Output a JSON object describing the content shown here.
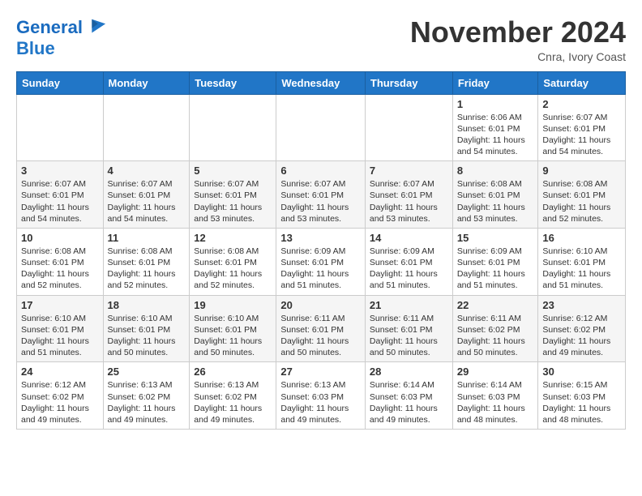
{
  "header": {
    "logo_line1": "General",
    "logo_line2": "Blue",
    "month_title": "November 2024",
    "location": "Cnra, Ivory Coast"
  },
  "days_of_week": [
    "Sunday",
    "Monday",
    "Tuesday",
    "Wednesday",
    "Thursday",
    "Friday",
    "Saturday"
  ],
  "weeks": [
    [
      {
        "day": "",
        "info": ""
      },
      {
        "day": "",
        "info": ""
      },
      {
        "day": "",
        "info": ""
      },
      {
        "day": "",
        "info": ""
      },
      {
        "day": "",
        "info": ""
      },
      {
        "day": "1",
        "info": "Sunrise: 6:06 AM\nSunset: 6:01 PM\nDaylight: 11 hours and 54 minutes."
      },
      {
        "day": "2",
        "info": "Sunrise: 6:07 AM\nSunset: 6:01 PM\nDaylight: 11 hours and 54 minutes."
      }
    ],
    [
      {
        "day": "3",
        "info": "Sunrise: 6:07 AM\nSunset: 6:01 PM\nDaylight: 11 hours and 54 minutes."
      },
      {
        "day": "4",
        "info": "Sunrise: 6:07 AM\nSunset: 6:01 PM\nDaylight: 11 hours and 54 minutes."
      },
      {
        "day": "5",
        "info": "Sunrise: 6:07 AM\nSunset: 6:01 PM\nDaylight: 11 hours and 53 minutes."
      },
      {
        "day": "6",
        "info": "Sunrise: 6:07 AM\nSunset: 6:01 PM\nDaylight: 11 hours and 53 minutes."
      },
      {
        "day": "7",
        "info": "Sunrise: 6:07 AM\nSunset: 6:01 PM\nDaylight: 11 hours and 53 minutes."
      },
      {
        "day": "8",
        "info": "Sunrise: 6:08 AM\nSunset: 6:01 PM\nDaylight: 11 hours and 53 minutes."
      },
      {
        "day": "9",
        "info": "Sunrise: 6:08 AM\nSunset: 6:01 PM\nDaylight: 11 hours and 52 minutes."
      }
    ],
    [
      {
        "day": "10",
        "info": "Sunrise: 6:08 AM\nSunset: 6:01 PM\nDaylight: 11 hours and 52 minutes."
      },
      {
        "day": "11",
        "info": "Sunrise: 6:08 AM\nSunset: 6:01 PM\nDaylight: 11 hours and 52 minutes."
      },
      {
        "day": "12",
        "info": "Sunrise: 6:08 AM\nSunset: 6:01 PM\nDaylight: 11 hours and 52 minutes."
      },
      {
        "day": "13",
        "info": "Sunrise: 6:09 AM\nSunset: 6:01 PM\nDaylight: 11 hours and 51 minutes."
      },
      {
        "day": "14",
        "info": "Sunrise: 6:09 AM\nSunset: 6:01 PM\nDaylight: 11 hours and 51 minutes."
      },
      {
        "day": "15",
        "info": "Sunrise: 6:09 AM\nSunset: 6:01 PM\nDaylight: 11 hours and 51 minutes."
      },
      {
        "day": "16",
        "info": "Sunrise: 6:10 AM\nSunset: 6:01 PM\nDaylight: 11 hours and 51 minutes."
      }
    ],
    [
      {
        "day": "17",
        "info": "Sunrise: 6:10 AM\nSunset: 6:01 PM\nDaylight: 11 hours and 51 minutes."
      },
      {
        "day": "18",
        "info": "Sunrise: 6:10 AM\nSunset: 6:01 PM\nDaylight: 11 hours and 50 minutes."
      },
      {
        "day": "19",
        "info": "Sunrise: 6:10 AM\nSunset: 6:01 PM\nDaylight: 11 hours and 50 minutes."
      },
      {
        "day": "20",
        "info": "Sunrise: 6:11 AM\nSunset: 6:01 PM\nDaylight: 11 hours and 50 minutes."
      },
      {
        "day": "21",
        "info": "Sunrise: 6:11 AM\nSunset: 6:01 PM\nDaylight: 11 hours and 50 minutes."
      },
      {
        "day": "22",
        "info": "Sunrise: 6:11 AM\nSunset: 6:02 PM\nDaylight: 11 hours and 50 minutes."
      },
      {
        "day": "23",
        "info": "Sunrise: 6:12 AM\nSunset: 6:02 PM\nDaylight: 11 hours and 49 minutes."
      }
    ],
    [
      {
        "day": "24",
        "info": "Sunrise: 6:12 AM\nSunset: 6:02 PM\nDaylight: 11 hours and 49 minutes."
      },
      {
        "day": "25",
        "info": "Sunrise: 6:13 AM\nSunset: 6:02 PM\nDaylight: 11 hours and 49 minutes."
      },
      {
        "day": "26",
        "info": "Sunrise: 6:13 AM\nSunset: 6:02 PM\nDaylight: 11 hours and 49 minutes."
      },
      {
        "day": "27",
        "info": "Sunrise: 6:13 AM\nSunset: 6:03 PM\nDaylight: 11 hours and 49 minutes."
      },
      {
        "day": "28",
        "info": "Sunrise: 6:14 AM\nSunset: 6:03 PM\nDaylight: 11 hours and 49 minutes."
      },
      {
        "day": "29",
        "info": "Sunrise: 6:14 AM\nSunset: 6:03 PM\nDaylight: 11 hours and 48 minutes."
      },
      {
        "day": "30",
        "info": "Sunrise: 6:15 AM\nSunset: 6:03 PM\nDaylight: 11 hours and 48 minutes."
      }
    ]
  ]
}
